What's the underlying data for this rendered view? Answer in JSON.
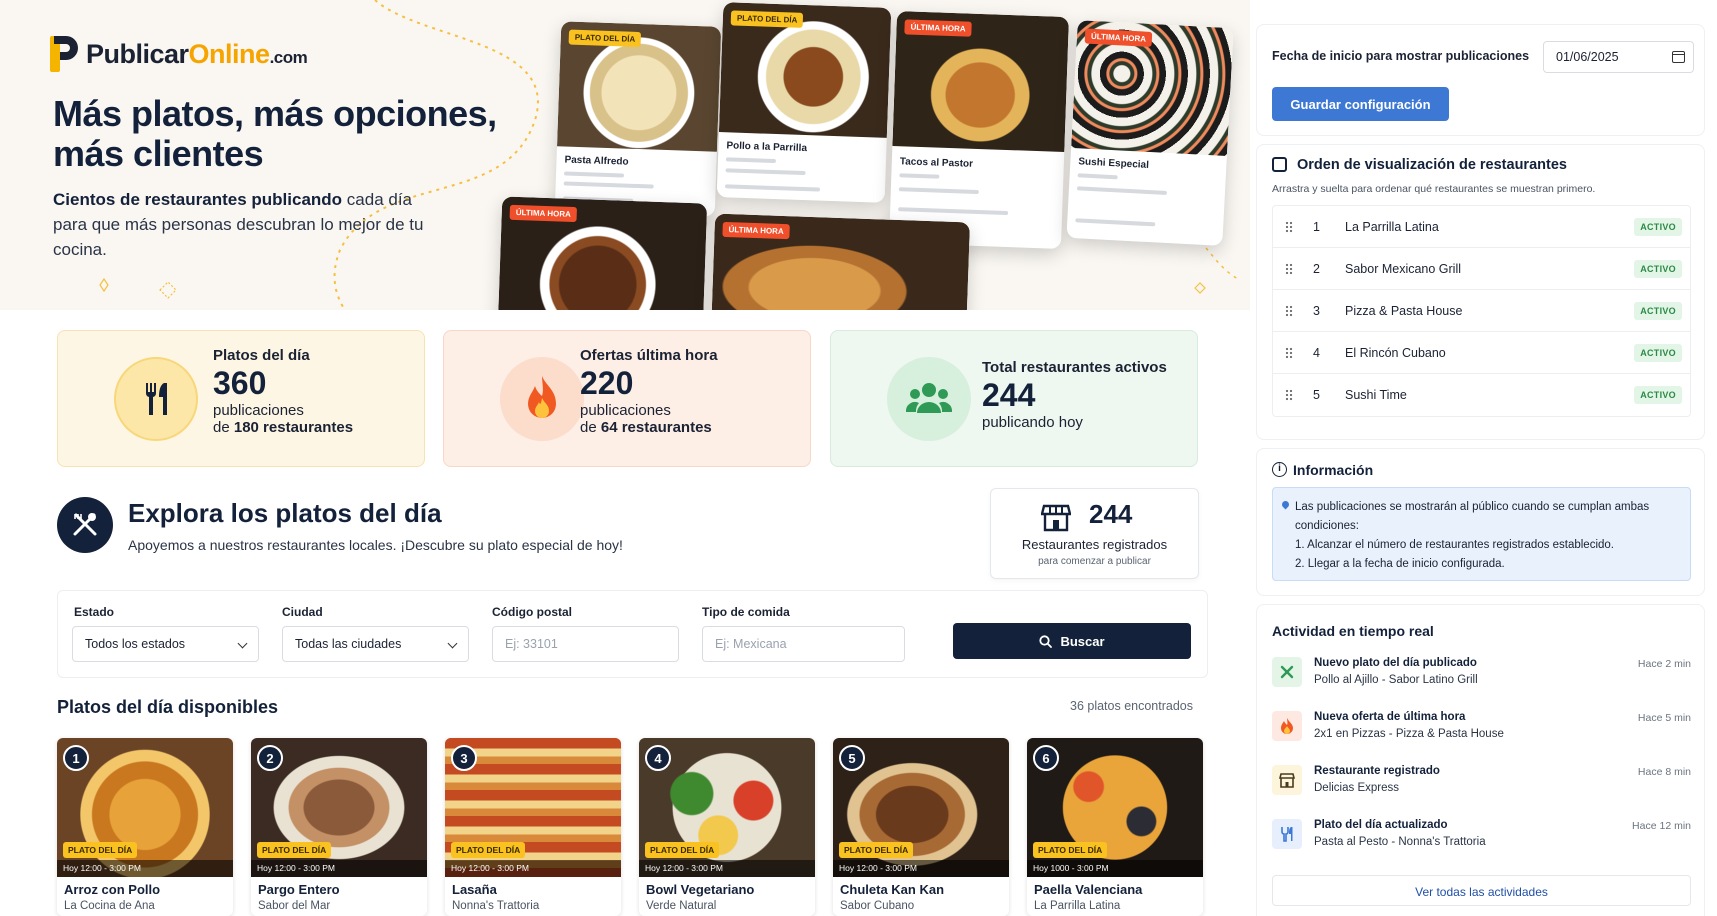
{
  "brand": {
    "name_part1": "Publicar",
    "name_part2": "Online",
    "name_part3": ".com"
  },
  "hero": {
    "title": "Más platos, más opciones, más clientes",
    "subtitle_bold": "Cientos de restaurantes publicando",
    "subtitle_rest": " cada día para que más personas descubran lo mejor de tu cocina.",
    "cards": [
      {
        "tag": "PLATO DEL DÍA",
        "name": "Pasta Alfredo"
      },
      {
        "tag": "PLATO DEL DÍA",
        "name": "Pollo a la Parrilla"
      },
      {
        "tag": "ÚLTIMA HORA",
        "name": "Tacos al Pastor"
      },
      {
        "tag": "ÚLTIMA HORA",
        "name": "Sushi Especial"
      },
      {
        "tag": "ÚLTIMA HORA",
        "name": ""
      },
      {
        "tag": "ÚLTIMA HORA",
        "name": ""
      }
    ]
  },
  "stats": [
    {
      "label": "Platos del día",
      "value": "360",
      "line2": "publicaciones",
      "line3_pre": "de ",
      "line3_bold": "180 restaurantes"
    },
    {
      "label": "Ofertas última hora",
      "value": "220",
      "line2": "publicaciones",
      "line3_pre": "de ",
      "line3_bold": "64 restaurantes"
    },
    {
      "label": "Total restaurantes activos",
      "value": "244",
      "line2": "publicando hoy"
    }
  ],
  "explore": {
    "title": "Explora los platos del día",
    "subtitle": "Apoyemos a nuestros restaurantes locales. ¡Descubre su plato especial de hoy!",
    "registered_value": "244",
    "registered_label": "Restaurantes registrados",
    "registered_sub": "para comenzar a publicar"
  },
  "filters": {
    "estado_label": "Estado",
    "estado_value": "Todos los estados",
    "ciudad_label": "Ciudad",
    "ciudad_value": "Todas las ciudades",
    "cp_label": "Código postal",
    "cp_placeholder": "Ej: 33101",
    "tipo_label": "Tipo de comida",
    "tipo_placeholder": "Ej: Mexicana",
    "search_label": "Buscar"
  },
  "dishes": {
    "title": "Platos del día disponibles",
    "count": "36 platos encontrados",
    "tag": "PLATO DEL DÍA",
    "items": [
      {
        "n": "1",
        "name": "Arroz con Pollo",
        "rest": "La Cocina de Ana",
        "hours": "Hoy 12:00 - 3:00 PM"
      },
      {
        "n": "2",
        "name": "Pargo Entero",
        "rest": "Sabor del Mar",
        "hours": "Hoy 12:00 - 3:00 PM"
      },
      {
        "n": "3",
        "name": "Lasaña",
        "rest": "Nonna's Trattoria",
        "hours": "Hoy 12:00 - 3:00 PM"
      },
      {
        "n": "4",
        "name": "Bowl Vegetariano",
        "rest": "Verde Natural",
        "hours": "Hoy 12:00 - 3:00 PM"
      },
      {
        "n": "5",
        "name": "Chuleta Kan Kan",
        "rest": "Sabor Cubano",
        "hours": "Hoy 12:00 - 3:00 PM"
      },
      {
        "n": "6",
        "name": "Paella Valenciana",
        "rest": "La Parrilla Latina",
        "hours": "Hoy 1000 - 3:00 PM"
      }
    ]
  },
  "config": {
    "date_label": "Fecha de inicio para mostrar publicaciones",
    "date_value": "01/06/2025",
    "save_label": "Guardar configuración"
  },
  "order": {
    "title": "Orden de visualización de restaurantes",
    "hint": "Arrastra y suelta para ordenar qué restaurantes se muestran primero.",
    "items": [
      {
        "n": "1",
        "name": "La Parrilla Latina",
        "status": "ACTIVO"
      },
      {
        "n": "2",
        "name": "Sabor Mexicano Grill",
        "status": "ACTIVO"
      },
      {
        "n": "3",
        "name": "Pizza & Pasta House",
        "status": "ACTIVO"
      },
      {
        "n": "4",
        "name": "El Rincón Cubano",
        "status": "ACTIVO"
      },
      {
        "n": "5",
        "name": "Sushi Time",
        "status": "ACTIVO"
      }
    ]
  },
  "info": {
    "title": "Información",
    "line1": "Las publicaciones se mostrarán al público cuando se cumplan ambas condiciones:",
    "line2": "1. Alcanzar el número de restaurantes registrados establecido.",
    "line3": "2. Llegar a la fecha de inicio configurada."
  },
  "activity": {
    "title": "Actividad en tiempo real",
    "items": [
      {
        "title": "Nuevo plato del día publicado",
        "desc": "Pollo al Ajillo - Sabor Latino Grill",
        "time": "Hace 2 min",
        "icon": "dish-icon",
        "color": "#e4f5e8"
      },
      {
        "title": "Nueva oferta de última hora",
        "desc": "2x1 en Pizzas - Pizza & Pasta House",
        "time": "Hace 5 min",
        "icon": "fire-icon",
        "color": "#fde9e2"
      },
      {
        "title": "Restaurante registrado",
        "desc": "Delicias Express",
        "time": "Hace 8 min",
        "icon": "store-icon",
        "color": "#fdf4dc"
      },
      {
        "title": "Plato del día actualizado",
        "desc": "Pasta al Pesto - Nonna's Trattoria",
        "time": "Hace 12 min",
        "icon": "utensils-icon",
        "color": "#e6effb"
      }
    ],
    "view_all": "Ver todas las actividades"
  },
  "colors": {
    "navy": "#13213a",
    "accent": "#3d78d4",
    "brand_yellow": "#f5a400",
    "active_green": "#2b8a45"
  }
}
